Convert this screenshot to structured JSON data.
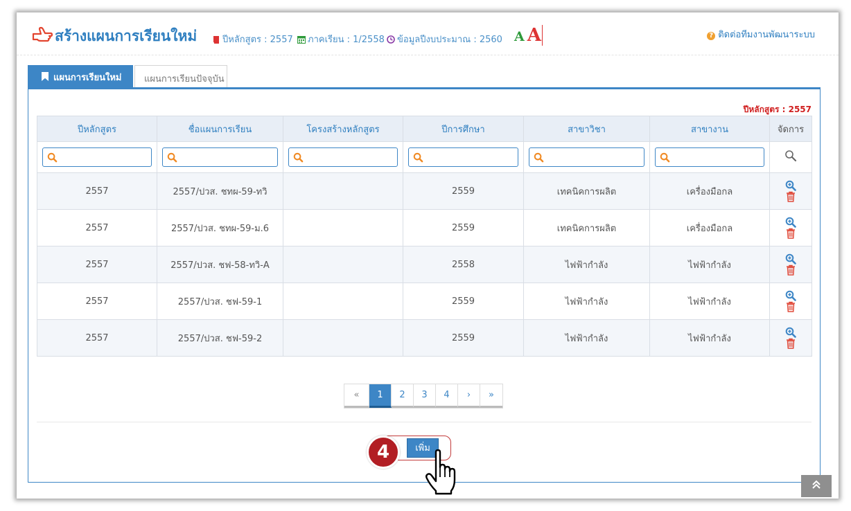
{
  "header": {
    "title": "สร้างแผนการเรียนใหม่",
    "curriculum_year": "ปีหลักสูตร : 2557",
    "semester": "ภาคเรียน : 1/2558",
    "budget_year": "ข้อมูลปีงบประมาณ : 2560",
    "font_small": "A",
    "font_large": "A",
    "contact": "ติดต่อทีมงานพัฒนาระบบ"
  },
  "tabs": [
    {
      "label": "แผนการเรียนใหม่",
      "active": true
    },
    {
      "label": "แผนการเรียนปัจจุบัน",
      "active": false
    }
  ],
  "panel": {
    "year_badge": "ปีหลักสูตร : 2557"
  },
  "table": {
    "columns": [
      "ปีหลักสูตร",
      "ชื่อแผนการเรียน",
      "โครงสร้างหลักสูตร",
      "ปีการศึกษา",
      "สาขาวิชา",
      "สาขางาน",
      "จัดการ"
    ],
    "rows": [
      [
        "2557",
        "2557/ปวส. ชทผ-59-ทวิ",
        "",
        "2559",
        "เทคนิคการผลิต",
        "เครื่องมือกล"
      ],
      [
        "2557",
        "2557/ปวส. ชทผ-59-ม.6",
        "",
        "2559",
        "เทคนิคการผลิต",
        "เครื่องมือกล"
      ],
      [
        "2557",
        "2557/ปวส. ชฟ-58-ทวิ-A",
        "",
        "2558",
        "ไฟฟ้ากำลัง",
        "ไฟฟ้ากำลัง"
      ],
      [
        "2557",
        "2557/ปวส. ชฟ-59-1",
        "",
        "2559",
        "ไฟฟ้ากำลัง",
        "ไฟฟ้ากำลัง"
      ],
      [
        "2557",
        "2557/ปวส. ชฟ-59-2",
        "",
        "2559",
        "ไฟฟ้ากำลัง",
        "ไฟฟ้ากำลัง"
      ]
    ]
  },
  "pagination": {
    "first": "«",
    "pages": [
      "1",
      "2",
      "3",
      "4"
    ],
    "active_page": "1",
    "next": "›",
    "last": "»"
  },
  "actions": {
    "step_number": "4",
    "add_label": "เพิ่ม"
  },
  "scroll_top": "«",
  "colors": {
    "primary": "#3d86c6",
    "danger": "#d01f1f",
    "search_orange": "#f08a24",
    "font_toggle_green": "#2e9a3a"
  }
}
